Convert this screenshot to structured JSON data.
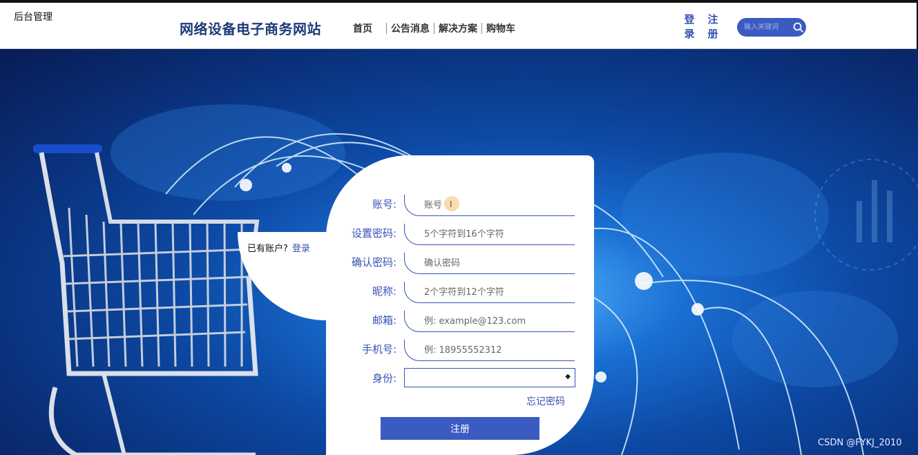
{
  "corner_text": "后台管理",
  "header": {
    "title": "网络设备电子商务网站",
    "nav": [
      "首页",
      "公告消息",
      "解决方案",
      "购物车"
    ],
    "login": "登录",
    "register": "注册",
    "search_placeholder": "输入关键词"
  },
  "side": {
    "prompt": "已有账户?",
    "login_link": "登录"
  },
  "form": {
    "fields": [
      {
        "label": "账号:",
        "placeholder": "账号"
      },
      {
        "label": "设置密码:",
        "placeholder": "5个字符到16个字符"
      },
      {
        "label": "确认密码:",
        "placeholder": "确认密码"
      },
      {
        "label": "昵称:",
        "placeholder": "2个字符到12个字符"
      },
      {
        "label": "邮箱:",
        "placeholder": "例: example@123.com"
      },
      {
        "label": "手机号:",
        "placeholder": "例: 18955552312"
      }
    ],
    "role_label": "身份:",
    "role_value": "",
    "forgot": "忘记密码",
    "submit": "注册"
  },
  "watermark": "CSDN @FYKJ_2010",
  "colors": {
    "accent": "#3b5bc1",
    "label": "#3552b5",
    "title": "#1f3a7a"
  }
}
